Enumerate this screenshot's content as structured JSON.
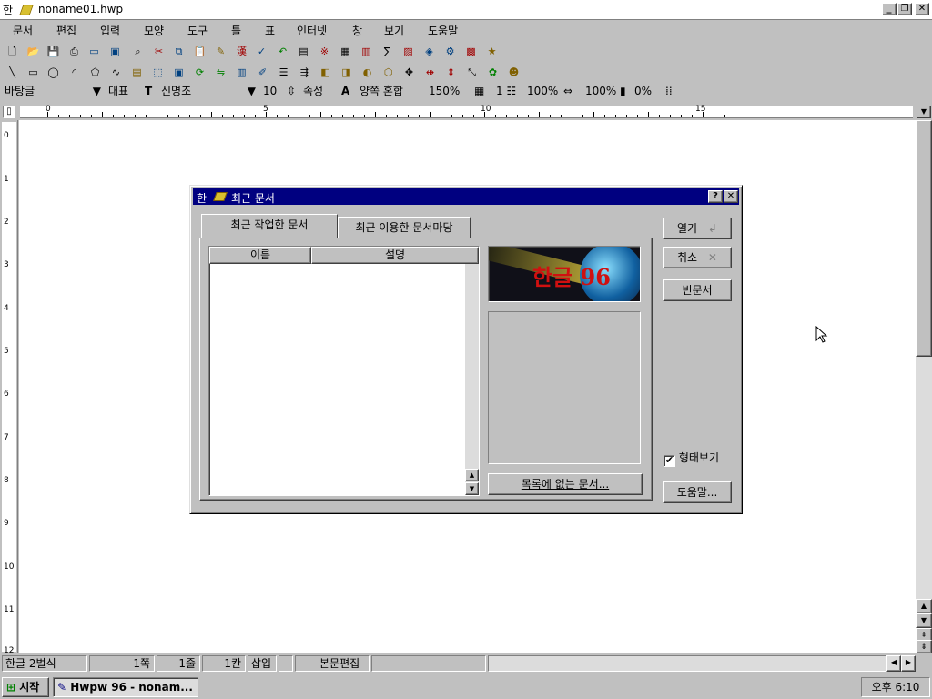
{
  "window": {
    "app_icon": "한",
    "title": "noname01.hwp",
    "min_label": "_",
    "restore_label": "❐",
    "close_label": "✕"
  },
  "menu": [
    "문서",
    "편집",
    "입력",
    "모양",
    "도구",
    "틀",
    "표",
    "인터넷",
    "창",
    "보기",
    "도움말"
  ],
  "format_bar": {
    "style": "바탕글",
    "font_group": "대표",
    "font_icon": "T",
    "font_name": "신명조",
    "font_size": "10",
    "attr_label": "속성",
    "char_icon": "A",
    "align": "양쪽 혼합",
    "line_spacing": "150%",
    "columns": "1",
    "width_ratio": "100%",
    "char_ratio": "100%",
    "char_spacing": "0%"
  },
  "ruler": {
    "numbers": [
      "0",
      "5",
      "10",
      "15"
    ],
    "vertical_numbers": [
      "0",
      "1",
      "2",
      "3",
      "4",
      "5",
      "6",
      "7",
      "8",
      "9",
      "10",
      "11",
      "12"
    ]
  },
  "dialog": {
    "app_icon": "한",
    "title": "최근 문서",
    "help_label": "?",
    "close_label": "✕",
    "tabs": [
      "최근 작업한 문서",
      "최근 이용한 문서마당"
    ],
    "columns": [
      "이름",
      "설명"
    ],
    "logo_text": "한글 96",
    "open_button": "열기",
    "cancel_button": "취소",
    "blank_button": "빈문서",
    "preview_checkbox": "형태보기",
    "preview_checked": true,
    "not_listed_button": "목록에 없는 문서...",
    "help_button": "도움말..."
  },
  "status": {
    "lang": "한글 2벌식",
    "page": "1쪽",
    "line": "1줄",
    "column": "1칸",
    "mode": "삽입",
    "edit": "본문편집"
  },
  "taskbar": {
    "start": "시작",
    "task": "Hwpw 96 - nonam...",
    "clock": "오후 6:10"
  },
  "colors": {
    "dialog_title_bg": "#000080",
    "face": "#c0c0c0",
    "logo_text": "#d01010"
  }
}
